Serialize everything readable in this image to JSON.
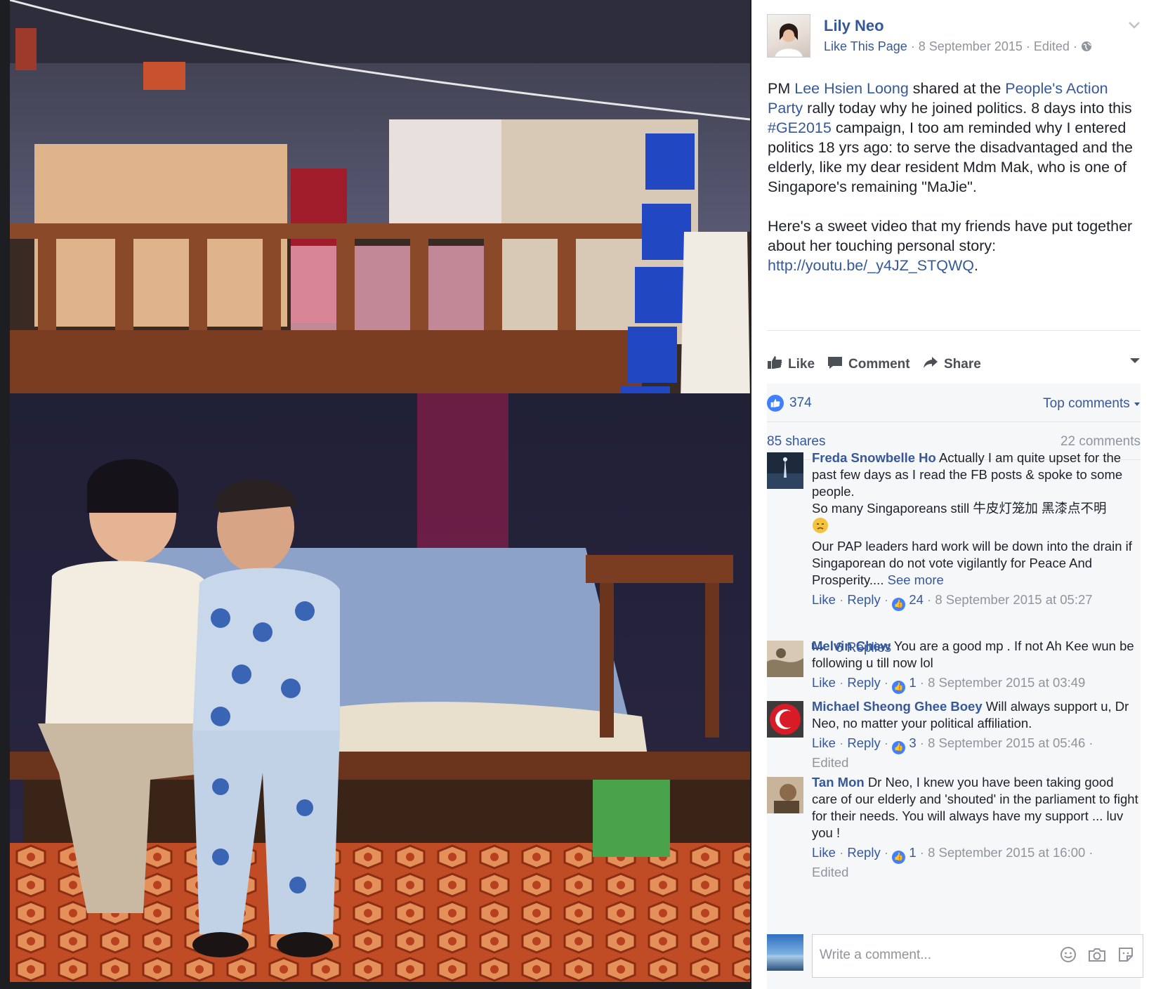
{
  "post": {
    "page_name": "Lily Neo",
    "like_page": "Like This Page",
    "date": "8 September 2015",
    "edited": "Edited",
    "text_parts": {
      "p1_a": "PM ",
      "p1_link1": "Lee Hsien Loong",
      "p1_b": " shared at the ",
      "p1_link2": "People's Action Party",
      "p1_c": " rally today why he joined politics. 8 days into this ",
      "p1_link3": "#GE2015",
      "p1_d": " campaign, I too am reminded why I entered politics 18 yrs ago: to serve the disadvantaged and the elderly, like my dear resident Mdm Mak, who is one of Singapore's remaining \"MaJie\".",
      "p2_a": "Here's a sweet video that my friends have put together about her touching personal story: ",
      "p2_link": "http://youtu.be/_y4JZ_STQWQ",
      "p2_b": "."
    }
  },
  "actions": {
    "like": "Like",
    "comment": "Comment",
    "share": "Share"
  },
  "stats": {
    "likes": "374",
    "top_comments": "Top comments",
    "shares": "85 shares",
    "comments": "22 comments"
  },
  "comments": [
    {
      "name": "Freda Snowbelle Ho",
      "text": "Actually I am quite upset for the past few days as I read the FB posts & spoke to some people.",
      "text2": "So many Singaporeans still 牛皮灯笼加 黑漆点不明",
      "text3": "Our PAP leaders hard work will be down into the drain if Singaporean do not vote vigilantly for Peace And Prosperity.... ",
      "see_more": "See more",
      "like": "Like",
      "reply": "Reply",
      "count": "24",
      "time": "8 September 2015 at 05:27",
      "replies": "6 Replies"
    },
    {
      "name": "Melvin Chew",
      "text": "You are a good mp . If not Ah Kee wun be following u till now lol",
      "like": "Like",
      "reply": "Reply",
      "count": "1",
      "time": "8 September 2015 at 03:49"
    },
    {
      "name": "Michael Sheong Ghee Boey",
      "text": "Will always support u, Dr Neo, no matter your political affiliation.",
      "like": "Like",
      "reply": "Reply",
      "count": "3",
      "time": "8 September 2015 at 05:46 ·",
      "edited": "Edited"
    },
    {
      "name": "Tan Mon",
      "text": "Dr Neo, I knew you have been taking good care of our elderly and 'shouted' in the parliament to fight for their needs. You will always have my support ... luv you !",
      "like": "Like",
      "reply": "Reply",
      "count": "1",
      "time": "8 September 2015 at 16:00 ·",
      "edited": "Edited"
    }
  ],
  "composer": {
    "placeholder": "Write a comment..."
  }
}
